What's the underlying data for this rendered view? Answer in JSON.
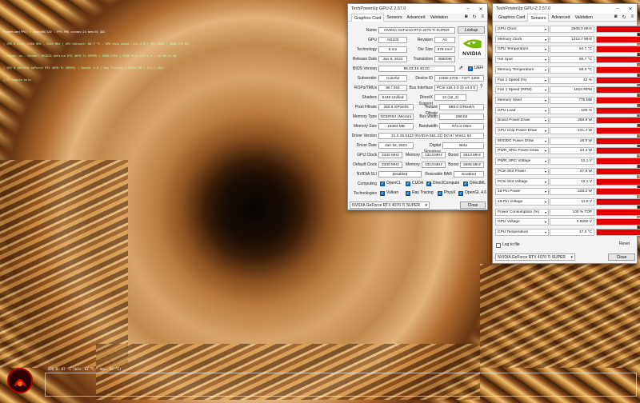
{
  "osd": {
    "lines": [
      "Frametime(FPS) : Vsync60/120 - FPS:996 uncaps:24 mem:0C ADL",
      "| GPU 0 Core: 2580 MHz - 2505 MHz | GPU Hotspot: 80.7 °C - GPU chip power: 231.4 W | 95% VRAM | VRAM 775 MB",
      "| PhysX: on - Vendor: NVIDIA GeForce RTX 4070 Ti SUPER | 10DE:2705 | GPU0 PCIe x16 4.0 | 16.9W 24.4W",
      "| GPU 0 (NVIDIA GeForce RTX 4070 Ti SUPER) | OpenGL 4.6 | Ray Tracing | 16384 MB | 672.3 GB/s",
      "| F1 toggle help"
    ],
    "bottom": "GPU 0: 67 °C (min: 61 °C - max: 67 °C)"
  },
  "gc": {
    "title": "TechPowerUp GPU-Z 2.57.0",
    "tabs": [
      "Graphics Card",
      "Sensors",
      "Advanced",
      "Validation"
    ],
    "name_label": "Name",
    "name_value": "NVIDIA GeForce RTX 4070 Ti SUPER",
    "lookup": "Lookup",
    "gpu_label": "GPU",
    "gpu_value": "AD103",
    "revision_label": "Revision",
    "revision_value": "A1",
    "tech_label": "Technology",
    "tech_value": "5 nm",
    "die_label": "Die Size",
    "die_value": "379 mm²",
    "release_label": "Release Date",
    "release_value": "Jan 8, 2024",
    "trans_label": "Transistors",
    "trans_value": "45900M",
    "bios_label": "BIOS Version",
    "bios_value": "95.03.45.40.2C",
    "uefi": "UEFI",
    "subvendor_label": "Subvendor",
    "subvendor_value": "Colorful",
    "devid_label": "Device ID",
    "devid_value": "10DE 2705 - 7377 1200",
    "rops_label": "ROPs/TMUs",
    "rops_value": "96 / 264",
    "bus_label": "Bus Interface",
    "bus_value": "PCIe x16 4.0 @ x4.0 0",
    "shaders_label": "Shaders",
    "shaders_value": "8448 Unified",
    "dx_label": "DirectX Support",
    "dx_value": "12 (12_2)",
    "pixel_label": "Pixel Fillrate",
    "pixel_value": "250.6 GPixel/s",
    "tex_label": "Texture Fillrate",
    "tex_value": "689.0 GTexel/s",
    "memtype_label": "Memory Type",
    "memtype_value": "GDDR6X (Micron)",
    "buswidth_label": "Bus Width",
    "buswidth_value": "256 bit",
    "memsize_label": "Memory Size",
    "memsize_value": "16384 MB",
    "bandwidth_label": "Bandwidth",
    "bandwidth_value": "672.3 GB/s",
    "driver_label": "Driver Version",
    "driver_value": "31.0.15.5122 (NVIDIA 551.22) DCH / Win11 64",
    "drvdate_label": "Driver Date",
    "drvdate_value": "Jan 18, 2024",
    "digsig_label": "Digital Signature",
    "digsig_value": "Beta",
    "gpuclock_label": "GPU Clock",
    "gpuclock_value": "2340 MHz",
    "memory_label": "Memory",
    "gpuclock_mem": "1313 MHz",
    "boost_label": "Boost",
    "gpuclock_boost": "2610 MHz",
    "defclock_label": "Default Clock",
    "defclock_value": "2340 MHz",
    "defclock_mem": "1313 MHz",
    "defclock_boost": "2685 MHz",
    "sli_label": "NVIDIA SLI",
    "sli_value": "Disabled",
    "rbar_label": "Resizable BAR",
    "rbar_value": "Enabled",
    "computing_label": "Computing",
    "opencl": "OpenCL",
    "cuda": "CUDA",
    "directcompute": "DirectCompute",
    "directml": "DirectML",
    "tech2_label": "Technologies",
    "vulkan": "Vulkan",
    "raytracing": "Ray Tracing",
    "physx": "PhysX",
    "opengl": "OpenGL 4.6",
    "footer_select": "NVIDIA GeForce RTX 4070 Ti SUPER",
    "close": "Close",
    "logo_text": "NVIDIA"
  },
  "sensors": {
    "title": "TechPowerUp GPU-Z 2.57.0",
    "tabs": [
      "Graphics Card",
      "Sensors",
      "Advanced",
      "Validation"
    ],
    "rows": [
      {
        "name": "GPU Clock",
        "value": "2505.0 MHz",
        "level": 1.0
      },
      {
        "name": "Memory Clock",
        "value": "1312.7 MHz",
        "level": 1.0
      },
      {
        "name": "GPU Temperature",
        "value": "64.7 °C",
        "level": 1.0
      },
      {
        "name": "Hot Spot",
        "value": "80.7 °C",
        "level": 1.0
      },
      {
        "name": "Memory Temperature",
        "value": "58.0 °C",
        "level": 1.0
      },
      {
        "name": "Fan 1 Speed (%)",
        "value": "42 %",
        "level": 1.0
      },
      {
        "name": "Fan 1 Speed (RPM)",
        "value": "1610 RPM",
        "level": 1.0
      },
      {
        "name": "Memory Used",
        "value": "775 MB",
        "level": 1.0
      },
      {
        "name": "GPU Load",
        "value": "100 %",
        "level": 1.0
      },
      {
        "name": "Board Power Draw",
        "value": "288.8 W",
        "level": 1.0
      },
      {
        "name": "GPU Chip Power Draw",
        "value": "231.4 W",
        "level": 1.0
      },
      {
        "name": "MVDDC Power Draw",
        "value": "16.9 W",
        "level": 1.0
      },
      {
        "name": "PWR_SRC Power Draw",
        "value": "24.4 W",
        "level": 1.0
      },
      {
        "name": "PWR_SRC Voltage",
        "value": "12.1 V",
        "level": 1.0
      },
      {
        "name": "PCIe Slot Power",
        "value": "27.8 W",
        "level": 1.0
      },
      {
        "name": "PCIe Slot Voltage",
        "value": "12.1 V",
        "level": 1.0
      },
      {
        "name": "16-Pin Power",
        "value": "228.2 W",
        "level": 1.0
      },
      {
        "name": "16-Pin Voltage",
        "value": "11.9 V",
        "level": 1.0
      },
      {
        "name": "Power Consumption (%)",
        "value": "100 % TDP",
        "level": 1.0
      },
      {
        "name": "GPU Voltage",
        "value": "0.9250 V",
        "level": 1.0
      },
      {
        "name": "CPU Temperature",
        "value": "47.0 °C",
        "level": 1.0
      }
    ],
    "log_label": "Log to file",
    "reset": "Reset",
    "footer_select": "NVIDIA GeForce RTX 4070 Ti SUPER",
    "close": "Close"
  },
  "colors": {
    "accent": "#1f6fbf",
    "graph": "#e30000",
    "nvidia_green": "#76b900"
  }
}
